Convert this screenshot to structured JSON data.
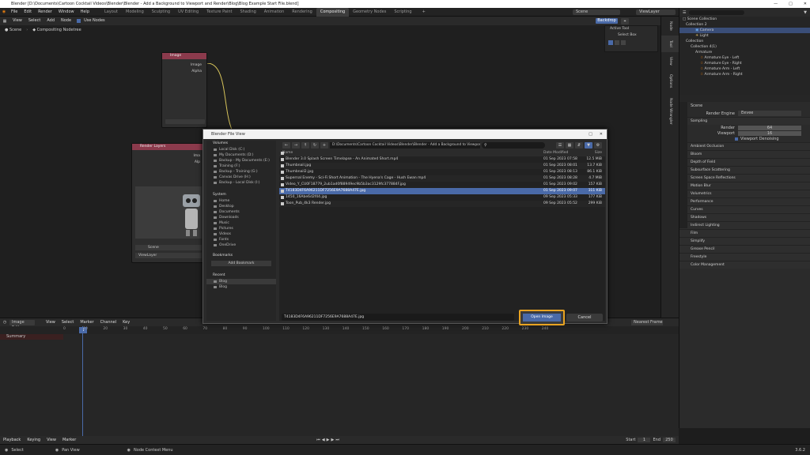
{
  "window": {
    "title": "Blender [D:\\Documents\\Cartoon Cocktail Videos\\Blender\\Blender - Add a Background to Viewport and Render\\Blog\\Blog Example Start File.blend]"
  },
  "menubar": {
    "menus": [
      "File",
      "Edit",
      "Render",
      "Window",
      "Help"
    ],
    "workspaces": [
      "Layout",
      "Modeling",
      "Sculpting",
      "UV Editing",
      "Texture Paint",
      "Shading",
      "Animation",
      "Rendering",
      "Compositing",
      "Geometry Nodes",
      "Scripting"
    ],
    "active_workspace": "Compositing",
    "scene_label": "Scene",
    "view_layer_label": "ViewLayer"
  },
  "node_editor": {
    "header_items": [
      "View",
      "Select",
      "Add",
      "Node"
    ],
    "use_nodes_label": "Use Nodes",
    "backdrop_label": "Backdrop",
    "breadcrumb_scene": "Scene",
    "breadcrumb_tree": "Compositing Nodetree",
    "image_node": {
      "title": "Image",
      "outputs": [
        "Image",
        "Alpha"
      ]
    },
    "render_node": {
      "title": "Render Layers",
      "outputs": [
        "Ima",
        "Alp"
      ],
      "scene": "Scene",
      "layer": "ViewLayer"
    },
    "sidebar_tabs": [
      "Node",
      "Tool",
      "View",
      "Options",
      "Node Wrangler"
    ],
    "active_tool_title": "Active Tool",
    "active_tool_name": "Select Box"
  },
  "outliner": {
    "search_placeholder": "",
    "root": "Scene Collection",
    "items": [
      "Collection 2",
      "Camera",
      "Light",
      "Collection",
      "Collection 4(1)",
      "Armature",
      "Armature Eye - Left",
      "Armature Eye - Right",
      "Armature Arm - Left",
      "Armature Arm - Right"
    ]
  },
  "properties": {
    "scene_name": "Scene",
    "render_engine_label": "Render Engine",
    "render_engine": "Eevee",
    "sampling_label": "Sampling",
    "render_label": "Render",
    "render_value": "64",
    "viewport_label": "Viewport",
    "viewport_value": "16",
    "viewport_denoising": "Viewport Denoising",
    "sections": [
      "Ambient Occlusion",
      "Bloom",
      "Depth of Field",
      "Subsurface Scattering",
      "Screen Space Reflections",
      "Motion Blur",
      "Volumetrics",
      "Performance",
      "Curves",
      "Shadows",
      "Indirect Lighting",
      "Film",
      "Simplify",
      "Grease Pencil",
      "Freestyle",
      "Color Management"
    ]
  },
  "dialog": {
    "title": "Blender File View",
    "path": "D:\\Documents\\Cartoon Cocktail Videos\\Blender\\Blender - Add a Background to Viewport and Render\\Blog\\",
    "volumes_label": "Volumes",
    "volumes": [
      "Local Disk (C:)",
      "My Documents (D:)",
      "Backup - My Documents (E:)",
      "Training (F:)",
      "Backup - Training (G:)",
      "Canvas Drive (H:)",
      "Backup - Local Disk (I:)"
    ],
    "system_label": "System",
    "system": [
      "Home",
      "Desktop",
      "Documents",
      "Downloads",
      "Music",
      "Pictures",
      "Videos",
      "Fonts",
      "OneDrive"
    ],
    "bookmarks_label": "Bookmarks",
    "add_bookmark": "Add Bookmark",
    "recent_label": "Recent",
    "recent": [
      "Blog",
      "Blog"
    ],
    "columns": {
      "name": "Name",
      "date": "Date Modified",
      "size": "Size"
    },
    "files": [
      {
        "name": "Blender 3.0 Splash Screen Timelapse - An Animated Short.mp4",
        "date": "01 Sep 2023 07:58",
        "size": "12.5 MiB"
      },
      {
        "name": "Thumbnail.jpg",
        "date": "01 Sep 2023 08:01",
        "size": "13.7 KiB"
      },
      {
        "name": "Thumbnail2.jpg",
        "date": "01 Sep 2023 08:13",
        "size": "86.1 KiB"
      },
      {
        "name": "Supernal Enemy - Sci-Fi Short Animation - The Hyena's Cage - Hush Ewan mp4",
        "date": "01 Sep 2023 08:28",
        "size": "4.7 MiB"
      },
      {
        "name": "Video_Y_CU0F18779_2ub1ad0f88949ec9b5b3ac3129fc377884F.jpg",
        "date": "01 Sep 2023 09:02",
        "size": "157 KiB"
      },
      {
        "name": "T4183D4F6A96211DF7256E9A7688A47E.jpg",
        "date": "01 Sep 2023 09:07",
        "size": "311 KiB"
      },
      {
        "name": "1450_16Abe6d2f44.jpg",
        "date": "09 Sep 2023 05:33",
        "size": "177 KiB"
      },
      {
        "name": "Toon_Pub_4k3 Render.jpg",
        "date": "09 Sep 2023 05:52",
        "size": "299 KiB"
      }
    ],
    "selected_index": 5,
    "filename": "T4183D4F6A96211DF7256E9A7688A47E.jpg",
    "open_label": "Open Image",
    "cancel_label": "Cancel"
  },
  "timeline": {
    "editor_label": "Image Editor",
    "header_items": [
      "View",
      "Select",
      "Marker",
      "Channel",
      "Key"
    ],
    "current_frame": "1",
    "frames": [
      "0",
      "10",
      "20",
      "30",
      "40",
      "50",
      "60",
      "70",
      "80",
      "90",
      "100",
      "110",
      "120",
      "130",
      "140",
      "150",
      "160",
      "170",
      "180",
      "190",
      "200",
      "210",
      "220",
      "230",
      "240"
    ],
    "track": "Summary",
    "nearest_frame": "Nearest Frame",
    "playback": "Playback",
    "keying": "Keying",
    "view": "View",
    "marker": "Marker",
    "start_label": "Start",
    "start_value": "1",
    "end_label": "End",
    "end_value": "250"
  },
  "statusbar": {
    "left": "Select",
    "middle": "Pan View",
    "context": "Node Context Menu",
    "version": "3.6.2"
  }
}
